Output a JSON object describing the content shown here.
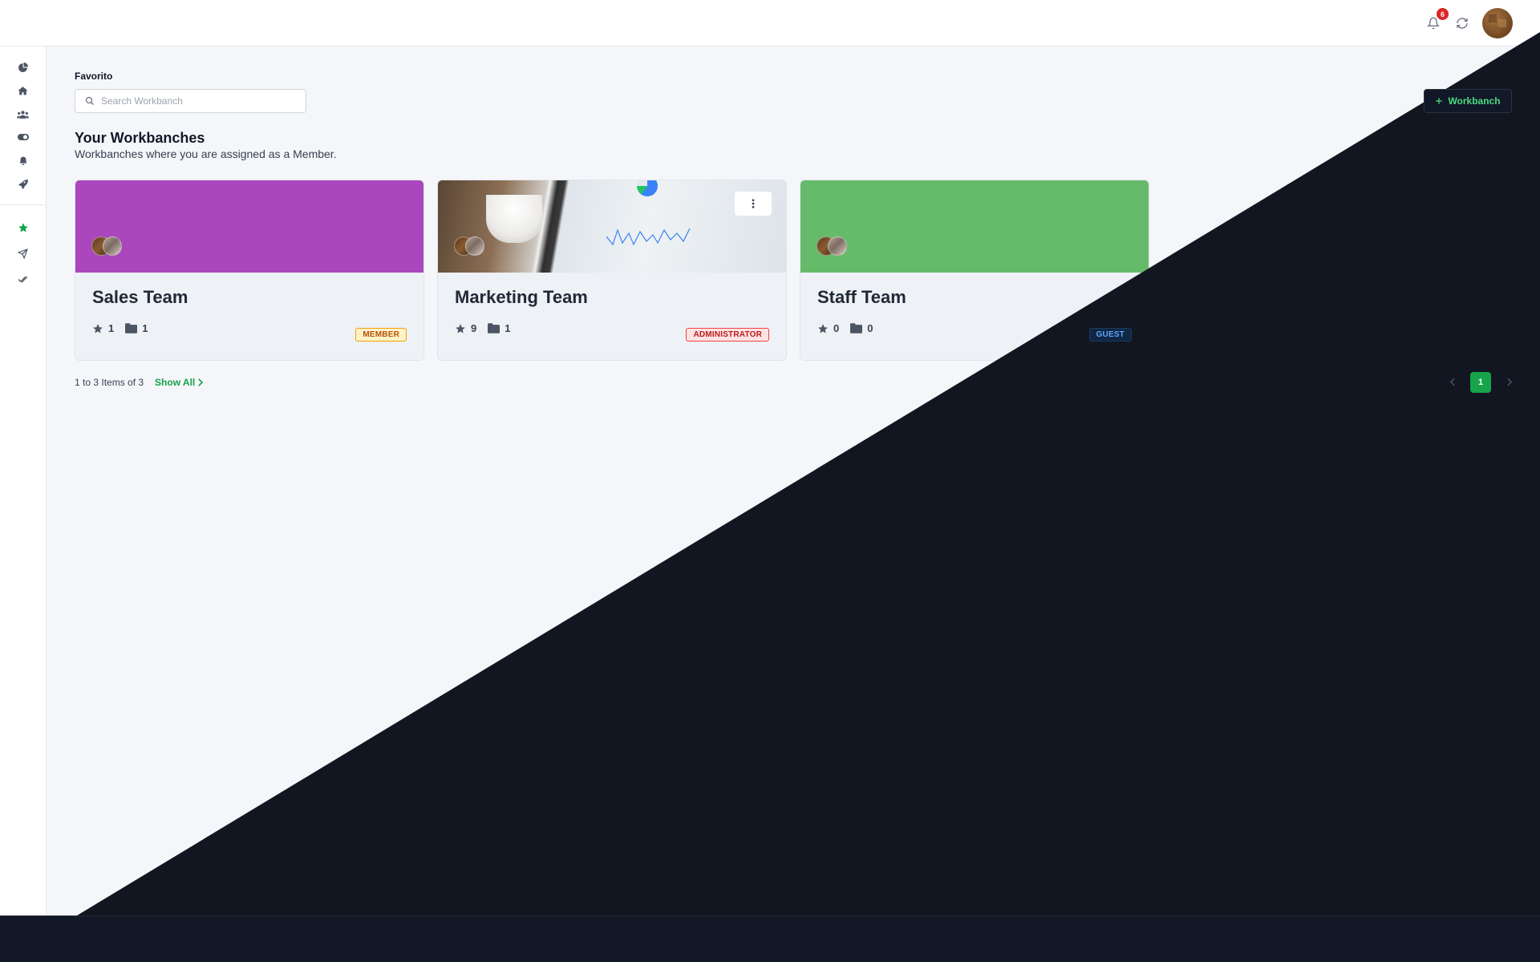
{
  "header": {
    "notifications_count": "6"
  },
  "sidebar": {
    "primary_icons": [
      "dashboard-icon",
      "home-icon",
      "users-icon",
      "toggle-icon",
      "bell-icon",
      "rocket-icon"
    ],
    "secondary_icons": [
      "star-icon",
      "send-icon",
      "double-check-icon"
    ],
    "collapse_icon": "collapse-icon"
  },
  "main": {
    "favorites_label": "Favorito",
    "search_placeholder": "Search Workbanch",
    "add_button_label": "Workbanch",
    "section_title": "Your Workbanches",
    "section_subtitle": "Workbanches where you are assigned as a Member.",
    "cards": [
      {
        "title": "Sales Team",
        "stars": "1",
        "folders": "1",
        "role": "MEMBER",
        "banner": "purple"
      },
      {
        "title": "Marketing Team",
        "stars": "9",
        "folders": "1",
        "role": "ADMINISTRATOR",
        "banner": "photo"
      },
      {
        "title": "Staff Team",
        "stars": "0",
        "folders": "0",
        "role": "GUEST",
        "banner": "green"
      }
    ],
    "list_summary": "1 to 3 Items of 3",
    "show_all_label": "Show All",
    "pagination": {
      "current_page": "1"
    }
  },
  "colors": {
    "accent": "#16a34a",
    "dark_overlay": "#111620",
    "sales_banner": "#ab47bc",
    "staff_banner": "#66bb6a"
  }
}
